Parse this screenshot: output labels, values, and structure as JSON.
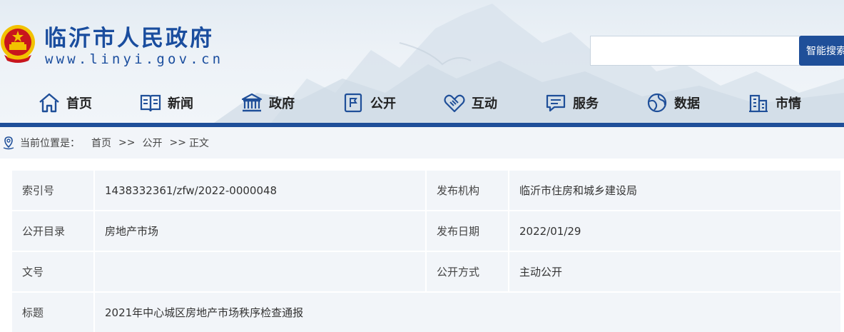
{
  "header": {
    "site_name": "临沂市人民政府",
    "site_url": "www.linyi.gov.cn"
  },
  "search": {
    "placeholder": "",
    "button_label": "智能搜索"
  },
  "nav": {
    "items": [
      {
        "label": "首页",
        "icon": "home-icon"
      },
      {
        "label": "新闻",
        "icon": "book-icon"
      },
      {
        "label": "政府",
        "icon": "building-icon"
      },
      {
        "label": "公开",
        "icon": "flag-icon"
      },
      {
        "label": "互动",
        "icon": "handshake-icon"
      },
      {
        "label": "服务",
        "icon": "chat-icon"
      },
      {
        "label": "数据",
        "icon": "globe-icon"
      },
      {
        "label": "市情",
        "icon": "city-icon"
      }
    ]
  },
  "breadcrumb": {
    "prefix": "当前位置是：",
    "items": [
      "首页",
      "公开",
      "正文"
    ],
    "separator": ">>"
  },
  "info": {
    "rows": [
      {
        "k1": "索引号",
        "v1": "1438332361/zfw/2022-0000048",
        "k2": "发布机构",
        "v2": "临沂市住房和城乡建设局"
      },
      {
        "k1": "公开目录",
        "v1": "房地产市场",
        "k2": "发布日期",
        "v2": "2022/01/29"
      },
      {
        "k1": "文号",
        "v1": "",
        "k2": "公开方式",
        "v2": "主动公开"
      },
      {
        "k1": "标题",
        "v1": "2021年中心城区房地产市场秩序检查通报"
      }
    ]
  },
  "colors": {
    "brand_blue": "#1f4f99",
    "title_blue": "#1a4d9e",
    "emblem_red": "#c8161d",
    "emblem_gold": "#f2c200",
    "panel_bg": "#f2f5f9"
  }
}
